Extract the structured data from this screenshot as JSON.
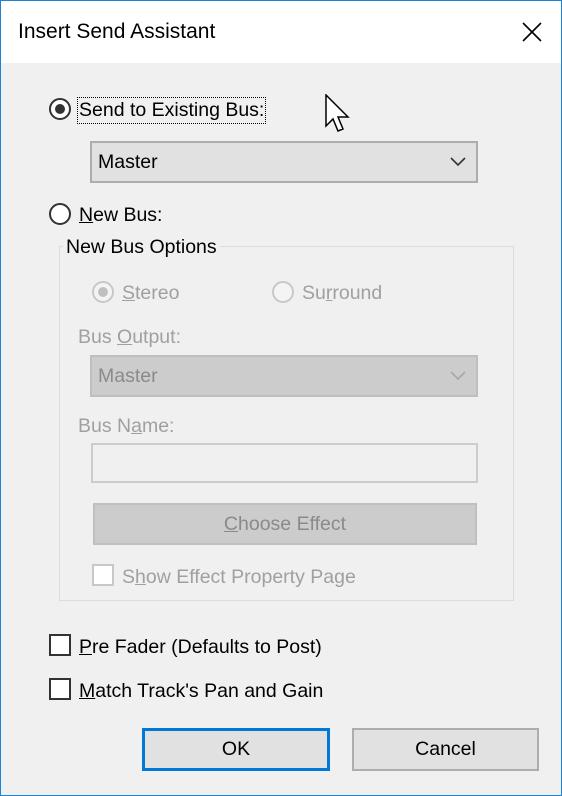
{
  "window": {
    "title": "Insert Send Assistant",
    "close_icon": "close-icon",
    "accent_color": "#0078d7"
  },
  "send_existing": {
    "label": "Send to Existing Bus:",
    "selected": true,
    "dropdown_value": "Master"
  },
  "new_bus": {
    "label_accel": "N",
    "label_rest": "ew Bus:",
    "selected": false
  },
  "new_bus_options": {
    "group_label": "New Bus Options",
    "stereo": {
      "accel": "S",
      "rest": "tereo",
      "selected": true,
      "enabled": false
    },
    "surround": {
      "pre": "Su",
      "accel": "r",
      "rest": "round",
      "selected": false,
      "enabled": false
    },
    "bus_output_label_pre": "Bus ",
    "bus_output_label_accel": "O",
    "bus_output_label_rest": "utput:",
    "bus_output_value": "Master",
    "bus_name_label_pre": "Bus N",
    "bus_name_label_accel": "a",
    "bus_name_label_rest": "me:",
    "bus_name_value": "",
    "choose_effect_accel": "C",
    "choose_effect_rest": "hoose Effect",
    "show_effect_pre": "S",
    "show_effect_accel": "h",
    "show_effect_rest": "ow Effect Property Page",
    "show_effect_checked": false
  },
  "pre_fader": {
    "accel": "P",
    "rest": "re Fader (Defaults to Post)",
    "checked": false
  },
  "match_track": {
    "accel": "M",
    "rest": "atch Track's Pan and Gain",
    "checked": false
  },
  "buttons": {
    "ok": "OK",
    "cancel": "Cancel"
  }
}
